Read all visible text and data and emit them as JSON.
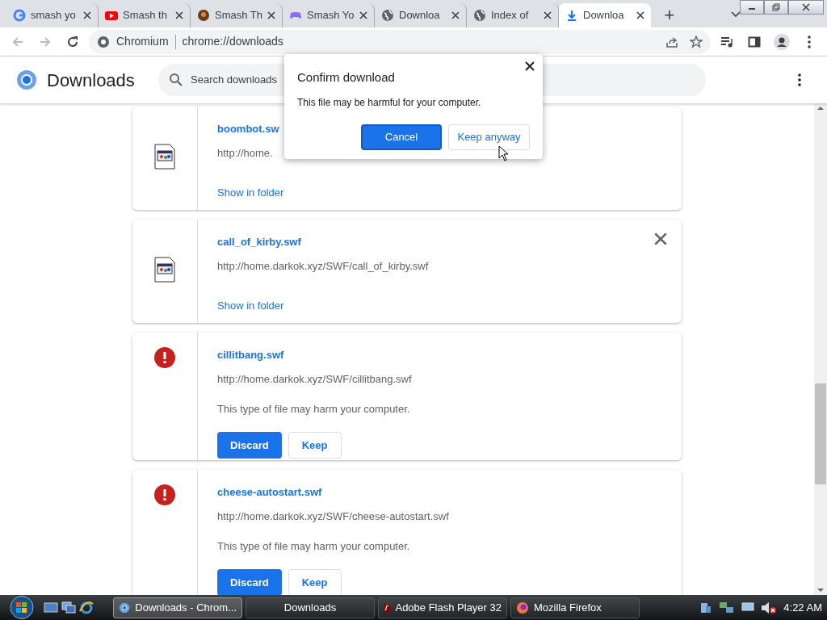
{
  "tabs": [
    {
      "title": "smash yo",
      "selected": false
    },
    {
      "title": "Smash th",
      "selected": false
    },
    {
      "title": "Smash Th",
      "selected": false
    },
    {
      "title": "Smash Yo",
      "selected": false
    },
    {
      "title": "Downloa",
      "selected": false
    },
    {
      "title": "Index of",
      "selected": false
    },
    {
      "title": "Downloa",
      "selected": true
    }
  ],
  "new_tab": "+",
  "address_bar": {
    "site": "Chromium",
    "url": "chrome://downloads"
  },
  "page": {
    "title": "Downloads",
    "search": {
      "placeholder": "Search downloads"
    }
  },
  "downloads": [
    {
      "kind": "file",
      "name": "boombot.sw",
      "url": "http://home.",
      "link": "Show in folder"
    },
    {
      "kind": "file",
      "name": "call_of_kirby.swf",
      "url": "http://home.darkok.xyz/SWF/call_of_kirby.swf",
      "link": "Show in folder"
    },
    {
      "kind": "dangerous",
      "name": "cillitbang.swf",
      "url": "http://home.darkok.xyz/SWF/cillitbang.swf",
      "warning": "This type of file may harm your computer.",
      "buttons": [
        "Discard",
        "Keep"
      ]
    },
    {
      "kind": "dangerous",
      "name": "cheese-autostart.swf",
      "url": "http://home.darkok.xyz/SWF/cheese-autostart.swf",
      "warning": "This type of file may harm your computer.",
      "buttons": [
        "Discard",
        "Keep"
      ]
    }
  ],
  "dialog": {
    "title": "Confirm download",
    "message": "This file may be harmful for your computer.",
    "buttons": [
      "Cancel",
      "Keep anyway"
    ]
  },
  "taskbar": {
    "items": [
      {
        "label": "Downloads - Chrom...",
        "selected": true
      },
      {
        "label": "Downloads",
        "selected": false
      },
      {
        "label": "Adobe Flash Player 32",
        "selected": false
      },
      {
        "label": "Mozilla Firefox",
        "selected": false
      }
    ],
    "clock": "4:22 AM"
  }
}
